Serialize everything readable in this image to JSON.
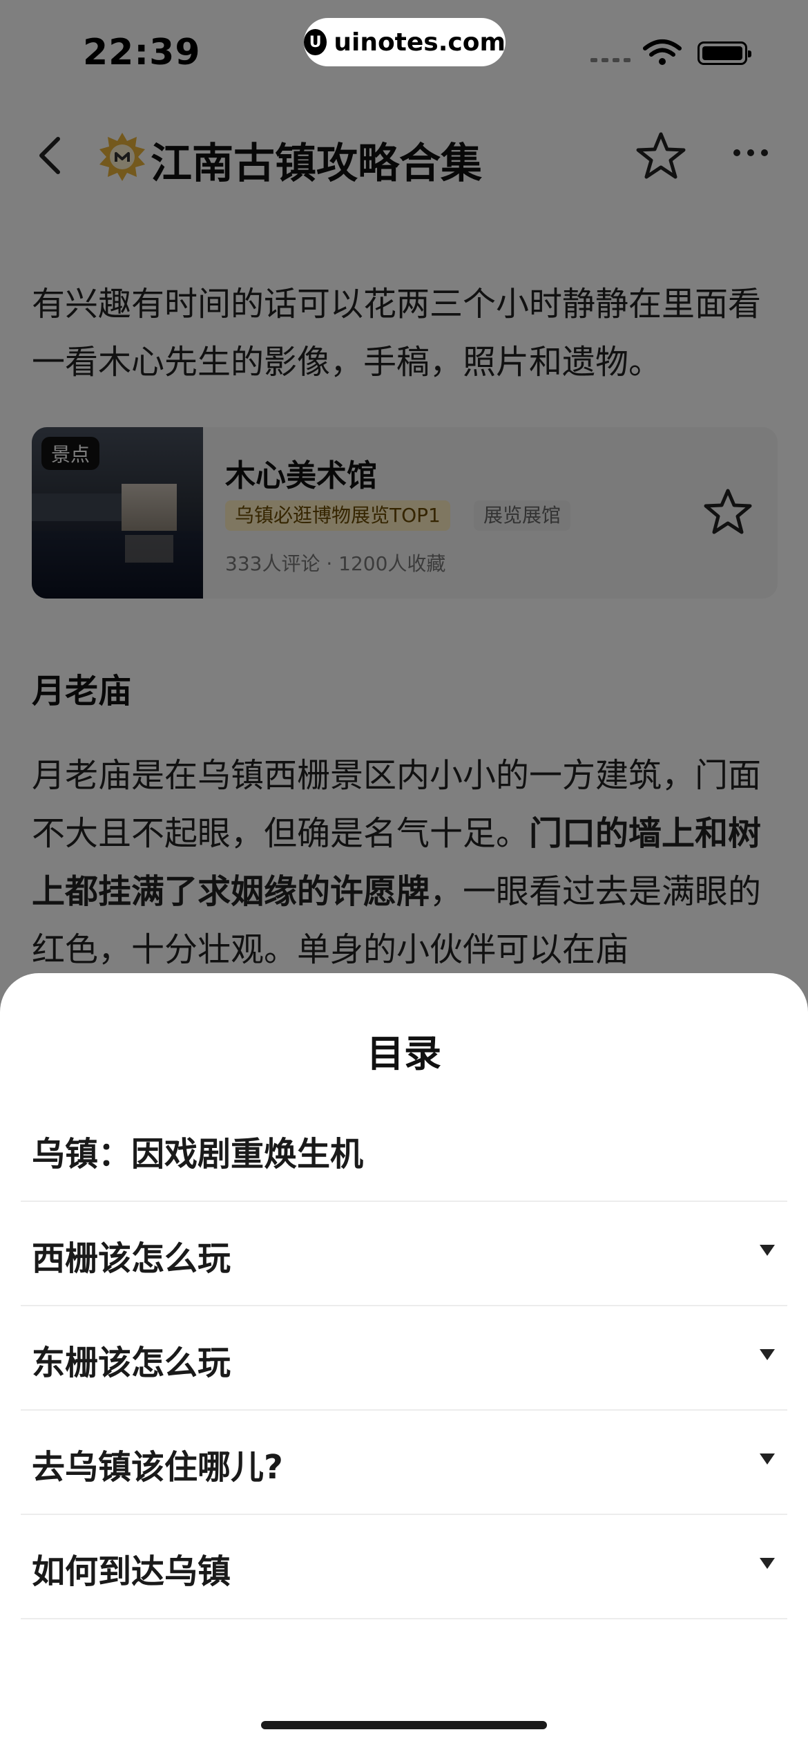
{
  "status_bar": {
    "time": "22:39"
  },
  "watermark": {
    "text": "uinotes.com"
  },
  "header": {
    "title": "江南古镇攻略合集"
  },
  "article": {
    "intro": "有兴趣有时间的话可以花两三个小时静静在里面看一看木心先生的影像，手稿，照片和遗物。",
    "poi_card": {
      "badge": "景点",
      "name": "木心美术馆",
      "tag_rank": "乌镇必逛博物展览TOP1",
      "tag_category": "展览展馆",
      "stats": "333人评论 · 1200人收藏"
    },
    "section_title": "月老庙",
    "section_text_1": "月老庙是在乌镇西栅景区内小小的一方建筑，门面不大且不起眼，但确是名气十足。",
    "section_text_bold": "门口的墙上和树上都挂满了求姻缘的许愿牌",
    "section_text_2": "，一眼看过去是满眼的红色，十分壮观。单身的小伙伴可以在庙"
  },
  "toc": {
    "title": "目录",
    "items": [
      {
        "label": "乌镇：因戏剧重焕生机",
        "expandable": false
      },
      {
        "label": "西栅该怎么玩",
        "expandable": true
      },
      {
        "label": "东栅该怎么玩",
        "expandable": true
      },
      {
        "label": "去乌镇该住哪儿?",
        "expandable": true
      },
      {
        "label": "如何到达乌镇",
        "expandable": true
      }
    ]
  },
  "colors": {
    "tag_rank_bg": "#ffeec2",
    "overlay": "rgba(0,0,0,0.5)",
    "sheet_bg": "#ffffff"
  }
}
